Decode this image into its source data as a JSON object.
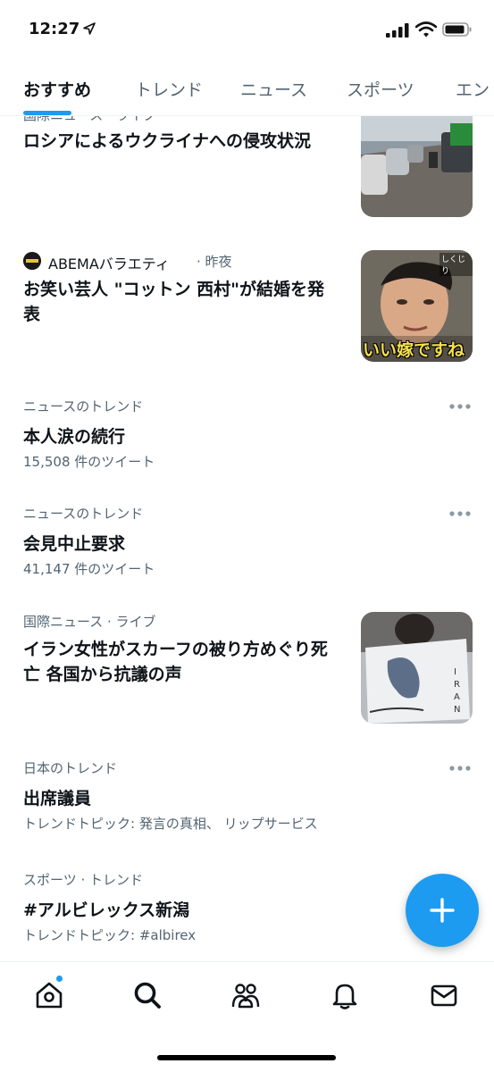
{
  "status_bar": {
    "time": "12:27"
  },
  "tabs": [
    {
      "label": "おすすめ",
      "active": true
    },
    {
      "label": "トレンド",
      "active": false
    },
    {
      "label": "ニュース",
      "active": false
    },
    {
      "label": "スポーツ",
      "active": false
    },
    {
      "label": "エン",
      "active": false
    }
  ],
  "feed": {
    "item1": {
      "meta": "国際ニュース · ライブ",
      "headline": "ロシアによるウクライナへの侵攻状況"
    },
    "item2": {
      "channel": "ABEMAバラエティ",
      "time": "· 昨夜",
      "headline": "お笑い芸人 \"コットン 西村\"が結婚を発表",
      "thumb_text": "いい嫁ですね",
      "thumb_corner": "しくじり"
    },
    "trend1": {
      "category": "ニュースのトレンド",
      "title": "本人涙の続行",
      "count": "15,508 件のツイート"
    },
    "trend2": {
      "category": "ニュースのトレンド",
      "title": "会見中止要求",
      "count": "41,147 件のツイート"
    },
    "item3": {
      "meta": "国際ニュース · ライブ",
      "headline": "イラン女性がスカーフの被り方めぐり死亡 各国から抗議の声"
    },
    "trend3": {
      "category": "日本のトレンド",
      "title": "出席議員",
      "topics": "トレンドトピック: 発言の真相、 リップサービス"
    },
    "trend4": {
      "category": "スポーツ · トレンド",
      "title": "#アルビレックス新潟",
      "topics": "トレンドトピック: #albirex"
    }
  },
  "colors": {
    "accent": "#1d9bf0",
    "text_primary": "#0f1419",
    "text_secondary": "#536471"
  },
  "bottom_nav": [
    {
      "icon": "home-icon",
      "has_notification_dot": true
    },
    {
      "icon": "search-icon",
      "active": true
    },
    {
      "icon": "communities-icon"
    },
    {
      "icon": "bell-icon"
    },
    {
      "icon": "mail-icon"
    }
  ]
}
